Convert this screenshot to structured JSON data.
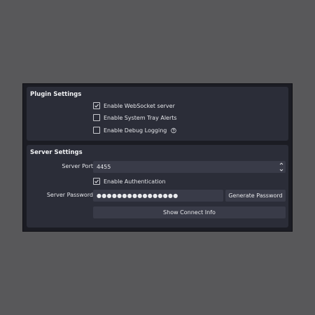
{
  "plugin_settings": {
    "title": "Plugin Settings",
    "options": [
      {
        "label": "Enable WebSocket server",
        "checked": true
      },
      {
        "label": "Enable System Tray Alerts",
        "checked": false
      },
      {
        "label": "Enable Debug Logging",
        "checked": false
      }
    ],
    "help_icon": "question-circle-icon"
  },
  "server_settings": {
    "title": "Server Settings",
    "port_label": "Server Port",
    "port_value": "4455",
    "auth_label": "Enable Authentication",
    "auth_checked": true,
    "password_label": "Server Password",
    "password_value": "●●●●●●●●●●●●●●●●",
    "generate_label": "Generate Password",
    "show_connect_label": "Show Connect Info"
  },
  "colors": {
    "background": "#58585a",
    "dialog": "#1b1c23",
    "group": "#2b2d38",
    "field": "#393b48",
    "text": "#e4e5e9"
  }
}
